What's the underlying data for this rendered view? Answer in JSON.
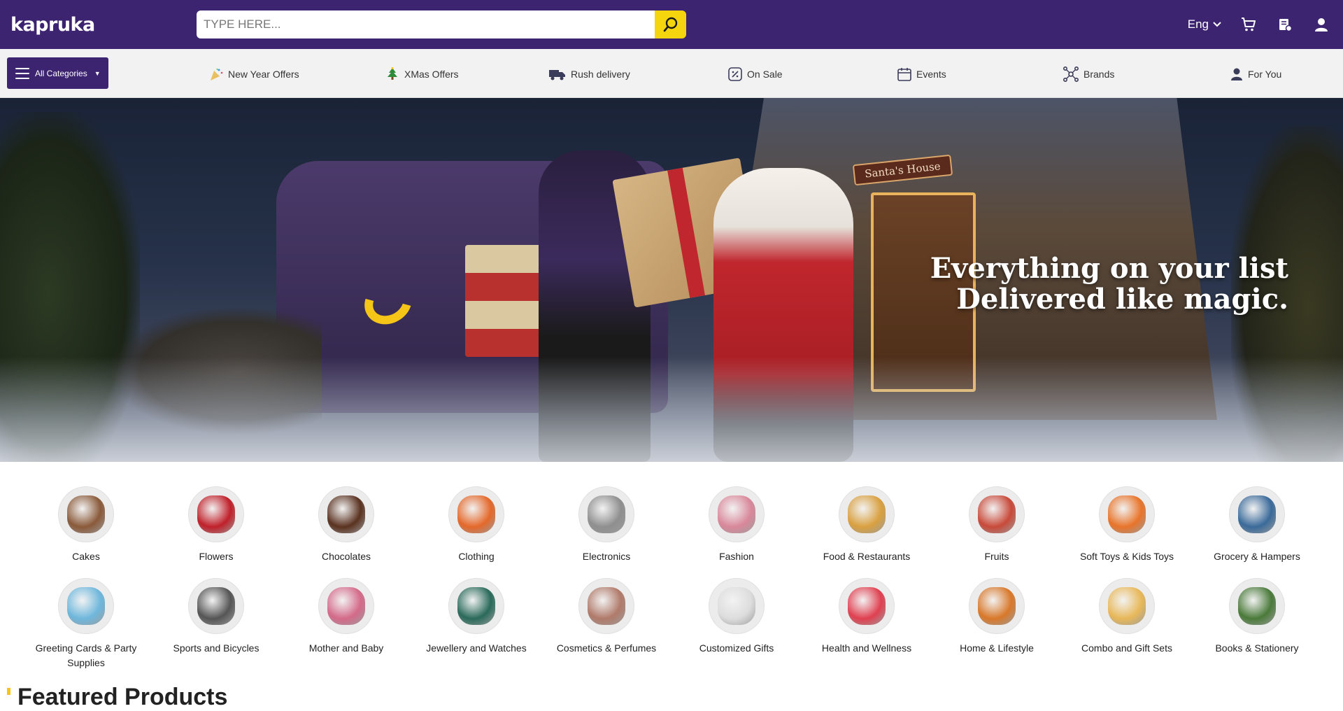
{
  "header": {
    "logo_text": "kapruka",
    "search_placeholder": "TYPE HERE...",
    "language": "Eng",
    "colors": {
      "brand_purple": "#3d2470",
      "accent_yellow": "#f5d60e"
    }
  },
  "nav": {
    "all_categories_label": "All Categories",
    "items": [
      {
        "label": "New Year Offers",
        "icon": "party-popper-icon"
      },
      {
        "label": "XMas Offers",
        "icon": "christmas-tree-icon"
      },
      {
        "label": "Rush delivery",
        "icon": "delivery-truck-icon"
      },
      {
        "label": "On Sale",
        "icon": "discount-tag-icon"
      },
      {
        "label": "Events",
        "icon": "calendar-icon"
      },
      {
        "label": "Brands",
        "icon": "brands-network-icon"
      },
      {
        "label": "For You",
        "icon": "user-icon"
      }
    ]
  },
  "hero": {
    "headline_line1": "Everything on your list",
    "headline_line2": "Delivered like magic.",
    "sign_text": "Santa's House"
  },
  "categories": [
    {
      "label": "Cakes",
      "color": "#8a5a3a"
    },
    {
      "label": "Flowers",
      "color": "#c0202a"
    },
    {
      "label": "Chocolates",
      "color": "#5a3220"
    },
    {
      "label": "Clothing",
      "color": "#e4682a"
    },
    {
      "label": "Electronics",
      "color": "#8f8f8f"
    },
    {
      "label": "Fashion",
      "color": "#d9889a"
    },
    {
      "label": "Food & Restaurants",
      "color": "#d9a040"
    },
    {
      "label": "Fruits",
      "color": "#c84a3a"
    },
    {
      "label": "Soft Toys & Kids Toys",
      "color": "#e8742a"
    },
    {
      "label": "Grocery & Hampers",
      "color": "#3a6a9a"
    },
    {
      "label": "Greeting Cards & Party Supplies",
      "color": "#6fb7dc"
    },
    {
      "label": "Sports and Bicycles",
      "color": "#555555"
    },
    {
      "label": "Mother and Baby",
      "color": "#d46a8a"
    },
    {
      "label": "Jewellery and Watches",
      "color": "#2a6a5a"
    },
    {
      "label": "Cosmetics & Perfumes",
      "color": "#b07a6a"
    },
    {
      "label": "Customized Gifts",
      "color": "#dddddd"
    },
    {
      "label": "Health and Wellness",
      "color": "#e04050"
    },
    {
      "label": "Home & Lifestyle",
      "color": "#d8782a"
    },
    {
      "label": "Combo and Gift Sets",
      "color": "#e8b85a"
    },
    {
      "label": "Books & Stationery",
      "color": "#4a7a3a"
    }
  ],
  "featured_title": "Featured Products"
}
